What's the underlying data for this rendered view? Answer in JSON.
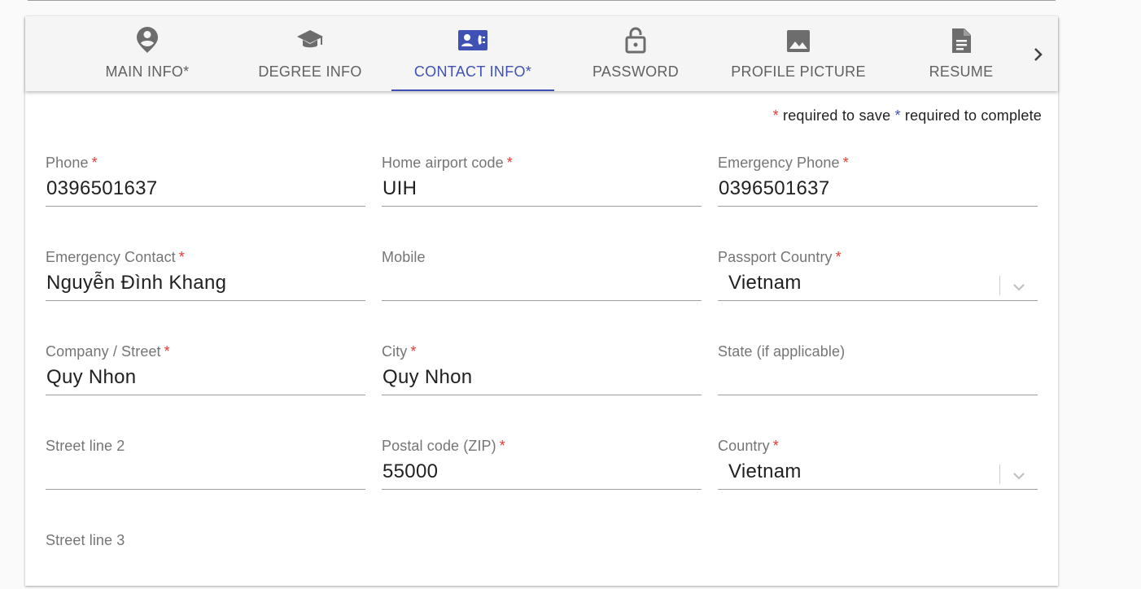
{
  "tabs": [
    {
      "label": "MAIN INFO*",
      "icon": "account-pin-icon"
    },
    {
      "label": "DEGREE INFO",
      "icon": "graduation-cap-icon"
    },
    {
      "label": "CONTACT INFO*",
      "icon": "contact-phone-icon",
      "active": true
    },
    {
      "label": "PASSWORD",
      "icon": "lock-open-icon"
    },
    {
      "label": "PROFILE PICTURE",
      "icon": "image-icon"
    },
    {
      "label": "RESUME",
      "icon": "document-icon"
    }
  ],
  "legend": {
    "star": "*",
    "save_text": " required to save ",
    "complete_text": " required to complete"
  },
  "required_marker": "*",
  "fields": {
    "phone": {
      "label": "Phone",
      "value": "0396501637"
    },
    "home_airport": {
      "label": "Home airport code",
      "value": "UIH"
    },
    "emergency_phone": {
      "label": "Emergency Phone",
      "value": "0396501637"
    },
    "emergency_contact": {
      "label": "Emergency Contact",
      "value": "Nguyễn Đình Khang"
    },
    "mobile": {
      "label": "Mobile",
      "value": ""
    },
    "passport_country": {
      "label": "Passport Country",
      "value": "Vietnam"
    },
    "company_street": {
      "label": "Company / Street",
      "value": "Quy Nhon"
    },
    "city": {
      "label": "City",
      "value": "Quy Nhon"
    },
    "state": {
      "label": "State (if applicable)",
      "value": ""
    },
    "street_line_2": {
      "label": "Street line 2",
      "value": ""
    },
    "postal_code": {
      "label": "Postal code (ZIP)",
      "value": "55000"
    },
    "country": {
      "label": "Country",
      "value": "Vietnam"
    },
    "street_line_3": {
      "label": "Street line 3",
      "value": ""
    }
  },
  "colors": {
    "accent": "#3f51b5",
    "required": "#e53935",
    "tab_text": "#616161",
    "label_text": "#757575"
  }
}
